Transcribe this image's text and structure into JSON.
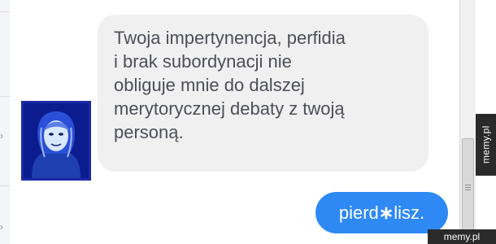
{
  "incoming_message": {
    "lines": [
      "Twoja impertynencja, perfidia",
      "i brak subordynacji nie",
      "obliguje mnie do dalszej",
      "merytorycznej debaty z twoją",
      "personą."
    ]
  },
  "outgoing_message": {
    "before": "pierd",
    "censor": "∗",
    "after": "lisz."
  },
  "watermark": {
    "side": "memy.pl",
    "bottom": "memy.pl"
  },
  "colors": {
    "incoming_bubble": "#f1f0f0",
    "outgoing_bubble": "#2e89f5",
    "avatar_bg": "#0a1a8c"
  },
  "icons": {
    "scroll_grip": "scroll-grip-icon"
  }
}
